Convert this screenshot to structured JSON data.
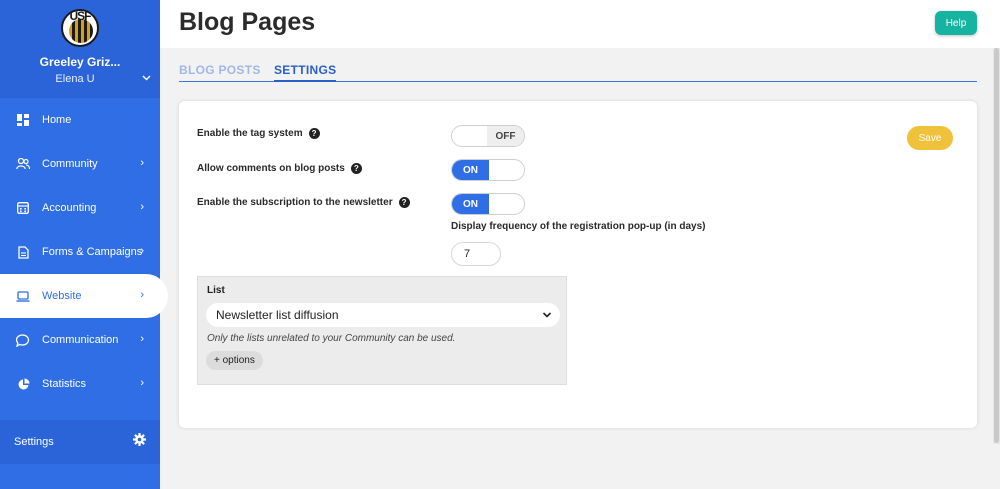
{
  "sidebar": {
    "org_name": "Greeley Griz...",
    "logo_text": "USF",
    "user_name": "Elena U",
    "items": [
      {
        "label": "Home",
        "icon": "home-grid-icon",
        "chevron": false
      },
      {
        "label": "Community",
        "icon": "people-icon",
        "chevron": true
      },
      {
        "label": "Accounting",
        "icon": "calculator-icon",
        "chevron": true
      },
      {
        "label": "Forms & Campaigns",
        "icon": "document-icon",
        "chevron": true
      },
      {
        "label": "Website",
        "icon": "laptop-icon",
        "chevron": true,
        "active": true
      },
      {
        "label": "Communication",
        "icon": "chat-icon",
        "chevron": true
      },
      {
        "label": "Statistics",
        "icon": "pie-chart-icon",
        "chevron": true
      }
    ],
    "settings_label": "Settings"
  },
  "header": {
    "title": "Blog Pages",
    "help_label": "Help"
  },
  "tabs": [
    {
      "label": "BLOG POSTS",
      "active": false
    },
    {
      "label": "SETTINGS",
      "active": true
    }
  ],
  "settings": {
    "tag_system": {
      "label": "Enable the tag system",
      "state": "OFF"
    },
    "comments": {
      "label": "Allow comments on blog posts",
      "state": "ON"
    },
    "newsletter": {
      "label": "Enable the subscription to the newsletter",
      "state": "ON"
    },
    "save_label": "Save",
    "frequency": {
      "label": "Display frequency of the registration pop-up (in days)",
      "value": "7"
    },
    "list": {
      "label": "List",
      "selected": "Newsletter list diffusion",
      "note": "Only the lists unrelated to your Community can be used.",
      "options_label": "+ options"
    }
  },
  "colors": {
    "sidebar": "#2f6ee5",
    "accent": "#2f6ee5",
    "help": "#17b3a1",
    "save": "#f0c23b"
  }
}
